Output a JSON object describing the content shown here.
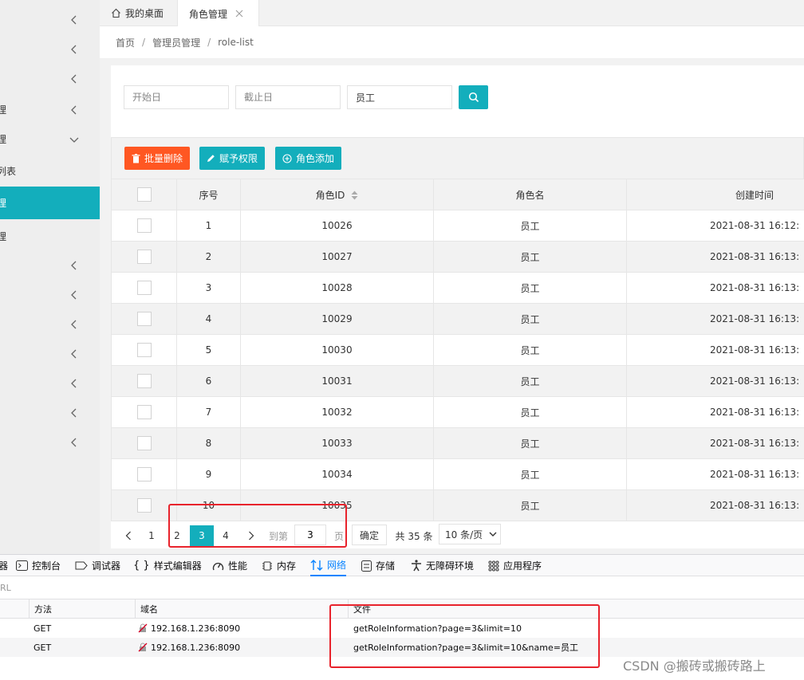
{
  "sidebar": {
    "items": [
      {
        "label": "",
        "expanded": false
      },
      {
        "label": "",
        "expanded": false
      },
      {
        "label": "",
        "expanded": false
      },
      {
        "label": "理",
        "expanded": false
      },
      {
        "label": "理",
        "expanded": true
      },
      {
        "label": "列表",
        "expanded": null
      },
      {
        "label": "理",
        "expanded": null,
        "active": true
      },
      {
        "label": "理",
        "expanded": null
      },
      {
        "label": "",
        "expanded": false
      },
      {
        "label": "",
        "expanded": false
      },
      {
        "label": "",
        "expanded": false
      },
      {
        "label": "",
        "expanded": false
      },
      {
        "label": "",
        "expanded": false
      },
      {
        "label": "",
        "expanded": false
      },
      {
        "label": "",
        "expanded": false
      }
    ]
  },
  "tabs": {
    "home": "我的桌面",
    "current": "角色管理"
  },
  "breadcrumb": [
    "首页",
    "管理员管理",
    "role-list"
  ],
  "filters": {
    "start_placeholder": "开始日",
    "end_placeholder": "截止日",
    "name_value": "员工"
  },
  "toolbar": {
    "batch_delete": "批量删除",
    "grant_permission": "赋予权限",
    "add_role": "角色添加"
  },
  "colors": {
    "accent": "#13aebc",
    "danger": "#ff5722",
    "devtools_active": "#0a84ff",
    "annotation": "#e8232c"
  },
  "table": {
    "headers": [
      "序号",
      "角色ID",
      "角色名",
      "创建时间"
    ],
    "rows": [
      {
        "no": "1",
        "id": "10026",
        "name": "员工",
        "time": "2021-08-31 16:12:"
      },
      {
        "no": "2",
        "id": "10027",
        "name": "员工",
        "time": "2021-08-31 16:13:"
      },
      {
        "no": "3",
        "id": "10028",
        "name": "员工",
        "time": "2021-08-31 16:13:"
      },
      {
        "no": "4",
        "id": "10029",
        "name": "员工",
        "time": "2021-08-31 16:13:"
      },
      {
        "no": "5",
        "id": "10030",
        "name": "员工",
        "time": "2021-08-31 16:13:"
      },
      {
        "no": "6",
        "id": "10031",
        "name": "员工",
        "time": "2021-08-31 16:13:"
      },
      {
        "no": "7",
        "id": "10032",
        "name": "员工",
        "time": "2021-08-31 16:13:"
      },
      {
        "no": "8",
        "id": "10033",
        "name": "员工",
        "time": "2021-08-31 16:13:"
      },
      {
        "no": "9",
        "id": "10034",
        "name": "员工",
        "time": "2021-08-31 16:13:"
      },
      {
        "no": "10",
        "id": "10035",
        "name": "员工",
        "time": "2021-08-31 16:13:"
      }
    ]
  },
  "pager": {
    "pages": [
      "1",
      "2",
      "3",
      "4"
    ],
    "current": "3",
    "goto_label": "到第",
    "goto_value": "3",
    "page_suffix": "页",
    "confirm": "确定",
    "total": "共 35 条",
    "page_size": "10 条/页"
  },
  "devtools": {
    "tabs": [
      {
        "icon": "inspector-icon",
        "label": "器"
      },
      {
        "icon": "console-icon",
        "label": "控制台"
      },
      {
        "icon": "debugger-icon",
        "label": "调试器"
      },
      {
        "icon": "style-editor-icon",
        "label": "样式编辑器"
      },
      {
        "icon": "performance-icon",
        "label": "性能"
      },
      {
        "icon": "memory-icon",
        "label": "内存"
      },
      {
        "icon": "network-icon",
        "label": "网络",
        "active": true
      },
      {
        "icon": "storage-icon",
        "label": "存储"
      },
      {
        "icon": "accessibility-icon",
        "label": "无障碍环境"
      },
      {
        "icon": "application-icon",
        "label": "应用程序"
      }
    ],
    "filter_text": "RL",
    "columns": [
      "方法",
      "域名",
      "文件"
    ],
    "requests": [
      {
        "method": "GET",
        "domain": "192.168.1.236:8090",
        "file": "getRoleInformation?page=3&limit=10"
      },
      {
        "method": "GET",
        "domain": "192.168.1.236:8090",
        "file": "getRoleInformation?page=3&limit=10&name=员工"
      }
    ]
  },
  "watermark": "CSDN @搬砖或搬砖路上"
}
